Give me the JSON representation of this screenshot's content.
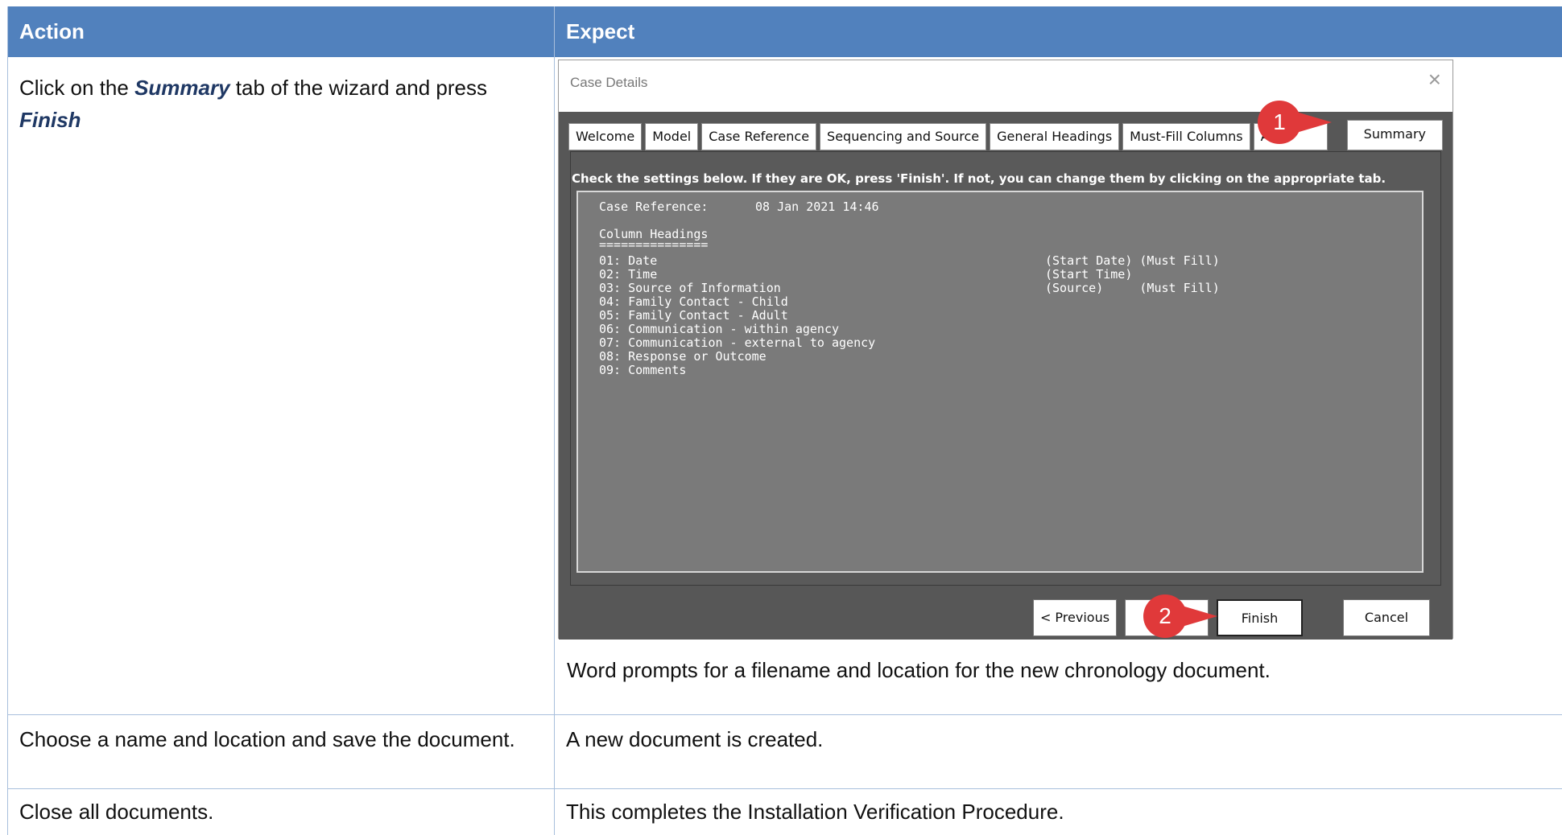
{
  "table": {
    "headers": [
      "Action",
      "Expect"
    ],
    "rows": [
      {
        "action_parts": [
          "Click on the ",
          "Summary",
          "  tab of the wizard and press ",
          "Finish"
        ],
        "expect": "Word prompts for a filename and location for the new chronology document."
      },
      {
        "action": "Choose a name and location and save the document.",
        "expect": "A new document is created."
      },
      {
        "action": "Close all documents.",
        "expect": "This completes the Installation Verification Procedure."
      }
    ]
  },
  "dialog": {
    "title": "Case Details",
    "close_glyph": "×",
    "tabs": [
      "Welcome",
      "Model",
      "Case Reference",
      "Sequencing and Source",
      "General Headings",
      "Must-Fill Columns",
      "Ab"
    ],
    "active_tab": "Summary",
    "instruction": "Check the settings below. If they are OK, press 'Finish'. If not, you can change them by clicking on the appropriate tab.",
    "summary": {
      "case_reference_label": "Case Reference:",
      "case_reference_value": "08 Jan 2021 14:46",
      "headings_title": "Column Headings",
      "underline": "===============",
      "columns": [
        {
          "text": "01: Date",
          "extra": "(Start Date) (Must Fill)"
        },
        {
          "text": "02: Time",
          "extra": "(Start Time)"
        },
        {
          "text": "03: Source of Information",
          "extra": "(Source)     (Must Fill)"
        },
        {
          "text": "04: Family Contact - Child",
          "extra": ""
        },
        {
          "text": "05: Family Contact - Adult",
          "extra": ""
        },
        {
          "text": "06: Communication - within agency",
          "extra": ""
        },
        {
          "text": "07: Communication - external to agency",
          "extra": ""
        },
        {
          "text": "08: Response or Outcome",
          "extra": ""
        },
        {
          "text": "09: Comments",
          "extra": ""
        }
      ]
    },
    "buttons": {
      "previous": "<  Previous",
      "finish": "Finish",
      "cancel": "Cancel"
    },
    "callouts": [
      "1",
      "2"
    ],
    "colors": {
      "callout": "#e0393a",
      "header": "#5181bd",
      "dialog_body": "#575757"
    }
  }
}
